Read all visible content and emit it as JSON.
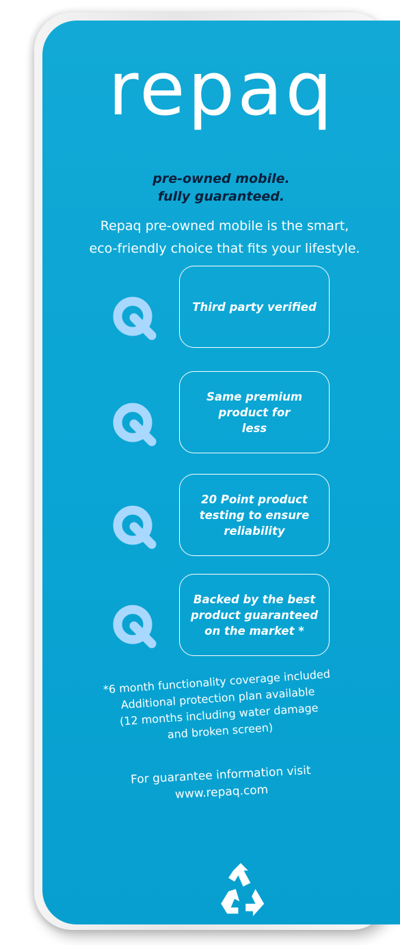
{
  "brand": {
    "logo_text": "repaq",
    "colors": {
      "panel": "#0aa5d4",
      "tagline": "#0a1f3a",
      "icon": "#a9d8ff",
      "text": "#ffffff"
    }
  },
  "tagline": {
    "line1": "pre-owned mobile.",
    "line2": "fully guaranteed."
  },
  "intro": {
    "line1": "Repaq pre-owned mobile is the smart,",
    "line2": "eco-friendly choice that fits your lifestyle."
  },
  "features": [
    {
      "icon": "repaq-q-icon",
      "text": "Third party verified"
    },
    {
      "icon": "repaq-q-icon",
      "text": "Same premium\nproduct for\nless"
    },
    {
      "icon": "repaq-q-icon",
      "text": "20 Point product\ntesting to ensure\nreliability"
    },
    {
      "icon": "repaq-q-icon",
      "text": "Backed by the best\nproduct guaranteed\non the market *"
    }
  ],
  "footnote": "*6 month functionality coverage included\nAdditional protection plan available\n(12 months including water damage\nand broken screen)",
  "visit": "For guarantee information visit\nwww.repaq.com",
  "footer_icon": "recycle-icon"
}
